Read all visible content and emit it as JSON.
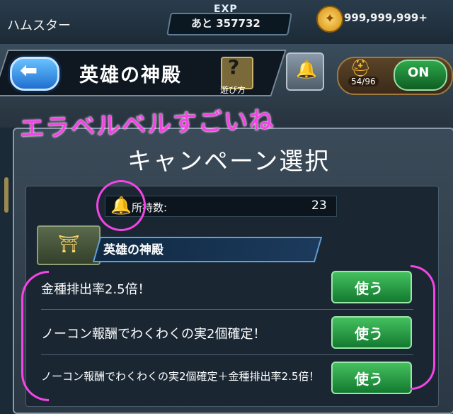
{
  "header": {
    "player_name": "ハムスター",
    "exp_label": "EXP",
    "exp_remaining": "あと 357732",
    "coins": "999,999,999+",
    "title": "英雄の神殿",
    "help_label": "遊び方",
    "help_glyph": "?",
    "auto_count": "54/96",
    "toggle_label": "ON"
  },
  "annotation": {
    "handwritten_note": "エラベルベルすごいね"
  },
  "modal": {
    "title": "キャンペーン選択",
    "owned_label": "所持数:",
    "owned_value": "23",
    "section_title": "英雄の神殿",
    "options": [
      {
        "label": "金種排出率2.5倍！",
        "button": "使う"
      },
      {
        "label": "ノーコン報酬でわくわくの実2個確定！",
        "button": "使う"
      },
      {
        "label": "ノーコン報酬でわくわくの実2個確定＋金種排出率2.5倍！",
        "button": "使う"
      }
    ]
  },
  "icons": {
    "back": "arrow-left-icon",
    "help": "question-icon",
    "bell": "bell-icon",
    "helmet": "helmet-icon",
    "coin": "coin-icon",
    "temple": "temple-icon"
  },
  "colors": {
    "annotation_pink": "#f544e6",
    "use_button_green": "#2ea84a",
    "back_button_blue": "#1f6fd0"
  }
}
